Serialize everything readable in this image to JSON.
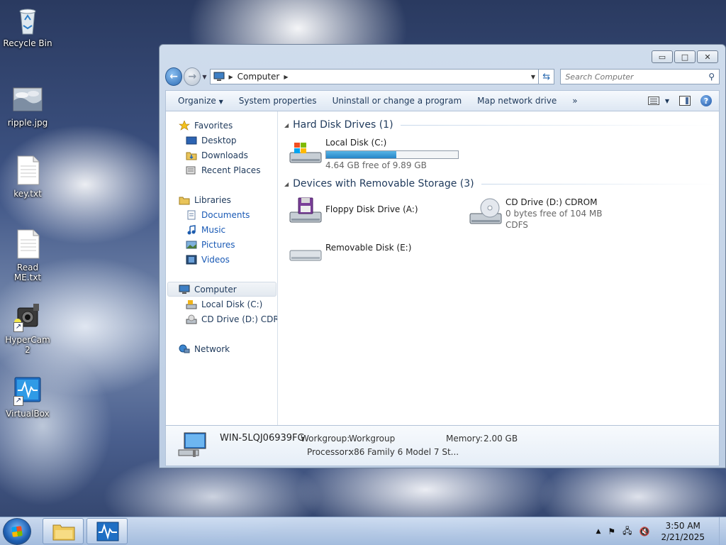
{
  "desktop": {
    "icons": [
      {
        "label": "Recycle Bin",
        "icon": "recycle-bin-icon"
      },
      {
        "label": "ripple.jpg",
        "icon": "image-file-icon"
      },
      {
        "label": "key.txt",
        "icon": "text-file-icon"
      },
      {
        "label": "Read ME.txt",
        "icon": "text-file-icon"
      },
      {
        "label": "HyperCam 2",
        "icon": "camera-icon"
      },
      {
        "label": "VirtualBox",
        "icon": "virtualbox-icon"
      }
    ]
  },
  "window": {
    "controls": {
      "minimize": "▭",
      "maximize": "□",
      "close": "✕"
    },
    "address": {
      "location": "Computer"
    },
    "search": {
      "placeholder": "Search Computer"
    },
    "toolbar": {
      "organize": "Organize",
      "system_properties": "System properties",
      "uninstall": "Uninstall or change a program",
      "map_drive": "Map network drive",
      "more": "»"
    },
    "nav": {
      "favorites": "Favorites",
      "desktop": "Desktop",
      "downloads": "Downloads",
      "recent": "Recent Places",
      "libraries": "Libraries",
      "documents": "Documents",
      "music": "Music",
      "pictures": "Pictures",
      "videos": "Videos",
      "computer": "Computer",
      "local_disk": "Local Disk (C:)",
      "cd_drive": "CD Drive (D:) CDROM",
      "network": "Network"
    },
    "groups": {
      "hdd": "Hard Disk Drives (1)",
      "removable": "Devices with Removable Storage (3)"
    },
    "drives": {
      "c": {
        "name": "Local Disk (C:)",
        "free": "4.64 GB free of 9.89 GB",
        "used_fraction": 0.53
      },
      "floppy": {
        "name": "Floppy Disk Drive (A:)"
      },
      "cd": {
        "name": "CD Drive (D:) CDROM",
        "free": "0 bytes free of 104 MB",
        "fs": "CDFS"
      },
      "removable": {
        "name": "Removable Disk (E:)"
      }
    },
    "details": {
      "computer_name": "WIN-5LQJ06939FG",
      "workgroup_label": "Workgroup:",
      "workgroup": "Workgroup",
      "memory_label": "Memory:",
      "memory": "2.00 GB",
      "processor_label": "Processor:",
      "processor": "x86 Family 6 Model 7 St..."
    }
  },
  "taskbar": {
    "clock_time": "3:50 AM",
    "clock_date": "2/21/2025"
  }
}
